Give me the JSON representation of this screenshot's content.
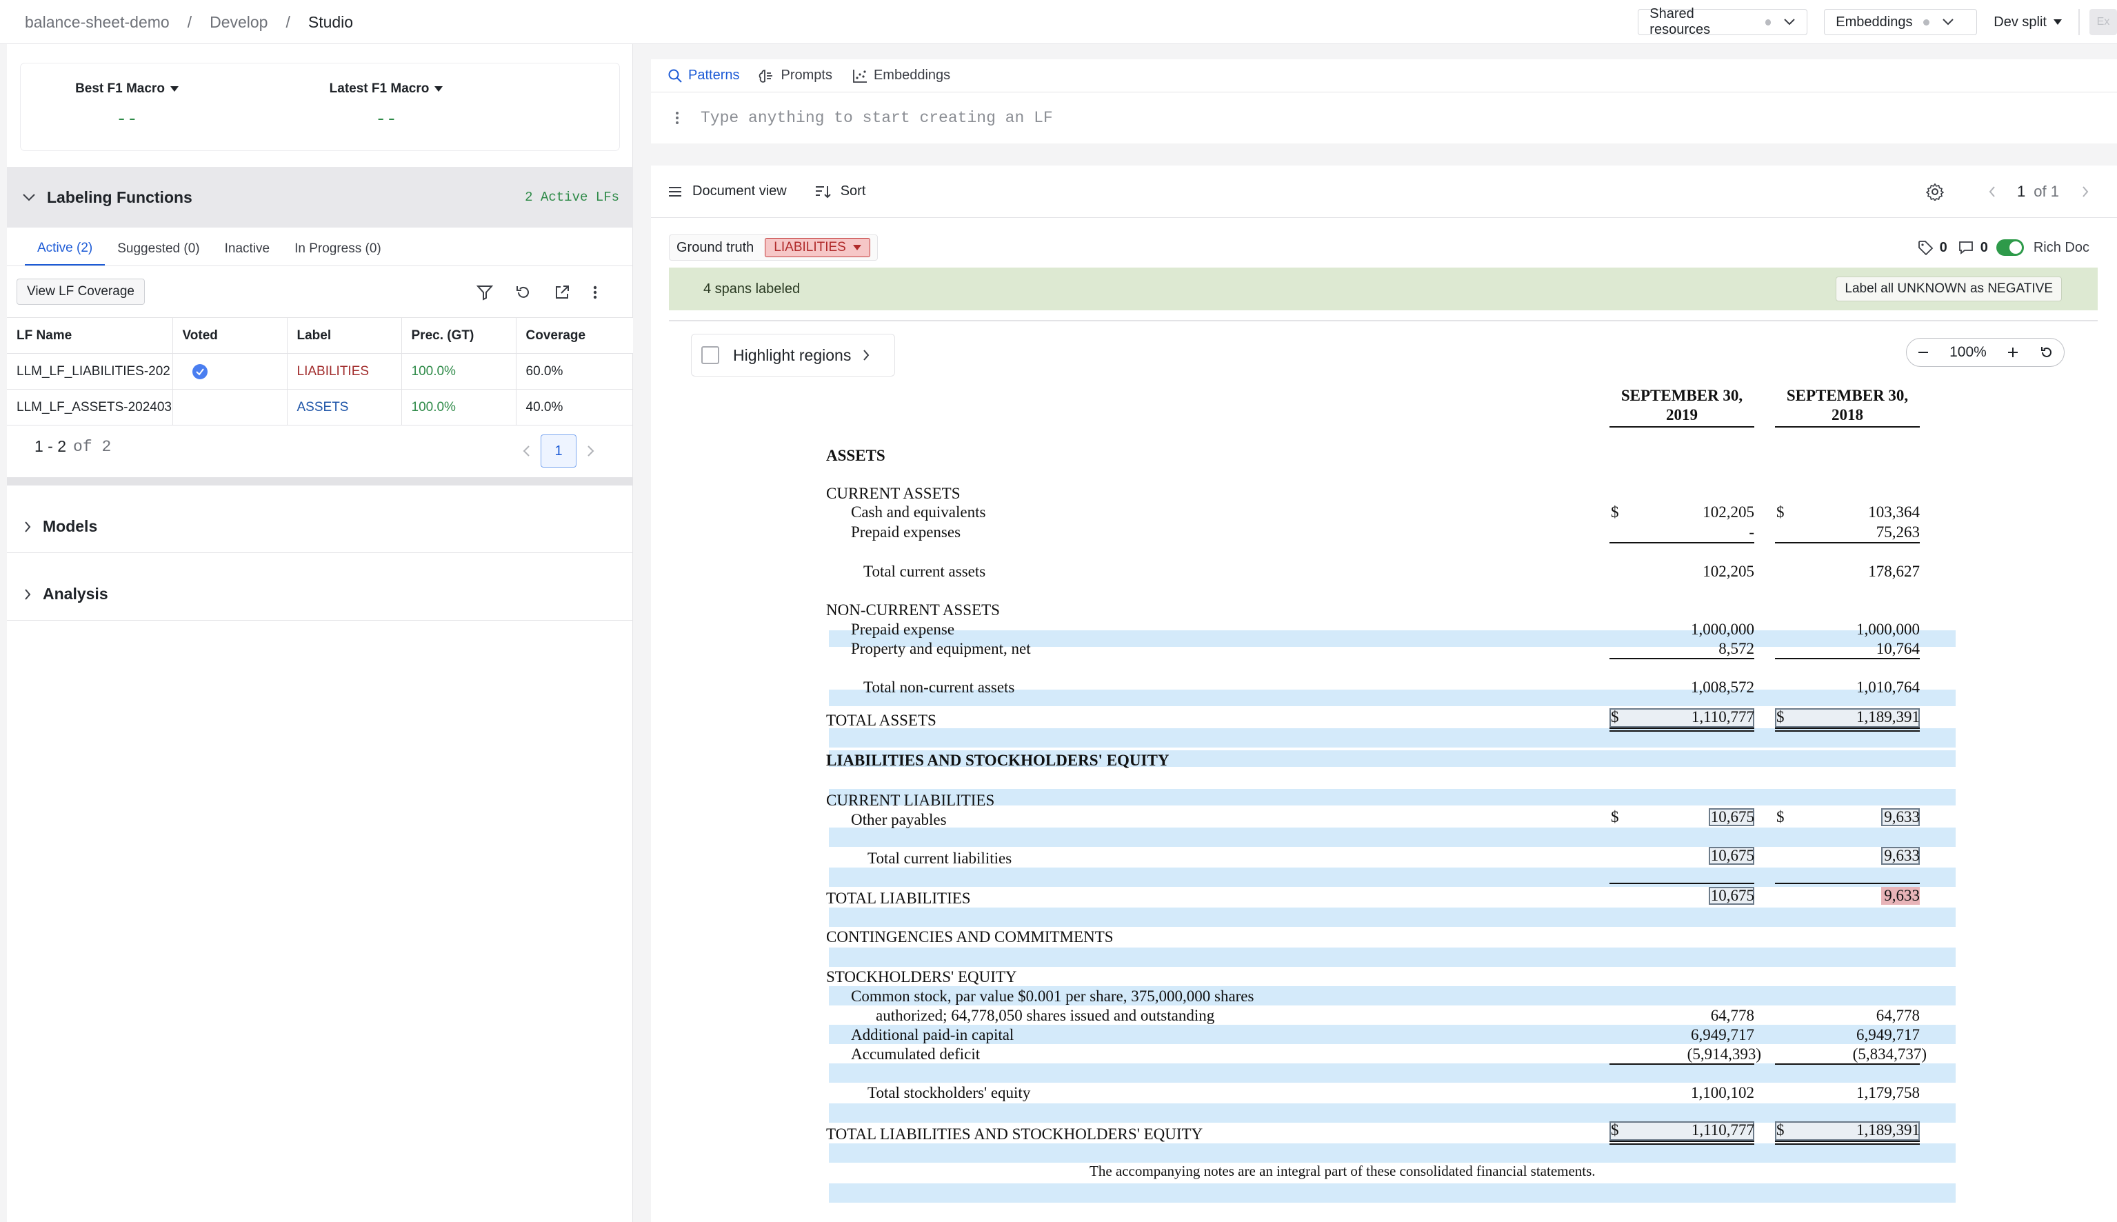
{
  "breadcrumb": {
    "project": "balance-sheet-demo",
    "section": "Develop",
    "current": "Studio",
    "separator": "/"
  },
  "topbar": {
    "shared_resources": "Shared resources",
    "embeddings": "Embeddings",
    "dev_split": "Dev split",
    "extra": "Ex"
  },
  "metrics": {
    "best_label": "Best F1 Macro",
    "best_value": "--",
    "latest_label": "Latest F1 Macro",
    "latest_value": "--"
  },
  "labeling_functions": {
    "title": "Labeling Functions",
    "active_count": "2 Active LFs",
    "tabs": [
      "Active (2)",
      "Suggested (0)",
      "Inactive",
      "In Progress (0)"
    ],
    "view_coverage": "View LF Coverage",
    "columns": [
      "LF Name",
      "Voted",
      "Label",
      "Prec. (GT)",
      "Coverage"
    ],
    "rows": [
      {
        "name": "LLM_LF_LIABILITIES-202",
        "label": "LIABILITIES",
        "prec": "100.0%",
        "coverage": "60.0%"
      },
      {
        "name": "LLM_LF_ASSETS-202403",
        "label": "ASSETS",
        "prec": "100.0%",
        "coverage": "40.0%"
      }
    ],
    "pager": {
      "range": "1 - 2",
      "of": "of 2",
      "page": "1"
    }
  },
  "sections": {
    "models": "Models",
    "analysis": "Analysis"
  },
  "panel_tabs": {
    "patterns": "Patterns",
    "prompts": "Prompts",
    "embeddings": "Embeddings"
  },
  "lf_input": {
    "placeholder": "Type anything to start creating an LF"
  },
  "doc_toolbar": {
    "document_view": "Document view",
    "sort": "Sort",
    "page": "1",
    "of": "of 1"
  },
  "ground_truth": {
    "label": "Ground truth",
    "value": "LIABILITIES"
  },
  "doc_counts": {
    "tags": "0",
    "comments": "0",
    "rich_doc": "Rich Doc"
  },
  "spans": {
    "text": "4 spans labeled",
    "button": "Label all UNKNOWN as NEGATIVE"
  },
  "highlight": {
    "label": "Highlight regions"
  },
  "zoom": {
    "level": "100%"
  },
  "colors": {
    "accent": "#1d5bd6",
    "success": "#2e8a48",
    "liabilities": "#a12c2c",
    "assets": "#1f55a8",
    "highlight": "#d4eafa"
  },
  "statement": {
    "col1": "SEPTEMBER 30, 2019",
    "col2": "SEPTEMBER 30, 2018",
    "assets": "ASSETS",
    "current_assets": "CURRENT ASSETS",
    "cash": {
      "label": "Cash and equivalents",
      "v1": "102,205",
      "v2": "103,364"
    },
    "prepaid": {
      "label": "Prepaid expenses",
      "v1": "-",
      "v2": "75,263"
    },
    "total_current": {
      "label": "Total current assets",
      "v1": "102,205",
      "v2": "178,627"
    },
    "non_current": "NON-CURRENT ASSETS",
    "prepaid_expense": {
      "label": "Prepaid expense",
      "v1": "1,000,000",
      "v2": "1,000,000"
    },
    "property": {
      "label": "Property and equipment, net",
      "v1": "8,572",
      "v2": "10,764"
    },
    "total_non_current": {
      "label": "Total non-current assets",
      "v1": "1,008,572",
      "v2": "1,010,764"
    },
    "total_assets": {
      "label": "TOTAL ASSETS",
      "v1": "1,110,777",
      "v2": "1,189,391"
    },
    "liab_equity": "LIABILITIES AND STOCKHOLDERS' EQUITY",
    "current_liab": "CURRENT LIABILITIES",
    "other_payables": {
      "label": "Other payables",
      "v1": "10,675",
      "v2": "9,633"
    },
    "total_current_liab": {
      "label": "Total current liabilities",
      "v1": "10,675",
      "v2": "9,633"
    },
    "total_liab": {
      "label": "TOTAL LIABILITIES",
      "v1": "10,675",
      "v2": "9,633"
    },
    "contingencies": "CONTINGENCIES AND COMMITMENTS",
    "equity": "STOCKHOLDERS' EQUITY",
    "common_stock_1": "Common stock, par value $0.001 per share, 375,000,000 shares",
    "common_stock_2": {
      "label": "authorized; 64,778,050 shares issued and outstanding",
      "v1": "64,778",
      "v2": "64,778"
    },
    "apic": {
      "label": "Additional paid-in capital",
      "v1": "6,949,717",
      "v2": "6,949,717"
    },
    "deficit": {
      "label": "Accumulated deficit",
      "v1": "(5,914,393)",
      "v2": "(5,834,737)"
    },
    "total_equity": {
      "label": "Total stockholders' equity",
      "v1": "1,100,102",
      "v2": "1,179,758"
    },
    "total_le": {
      "label": "TOTAL LIABILITIES AND STOCKHOLDERS' EQUITY",
      "v1": "1,110,777",
      "v2": "1,189,391"
    },
    "footnote": "The accompanying notes are an integral part of these consolidated financial statements.",
    "dollar": "$"
  }
}
